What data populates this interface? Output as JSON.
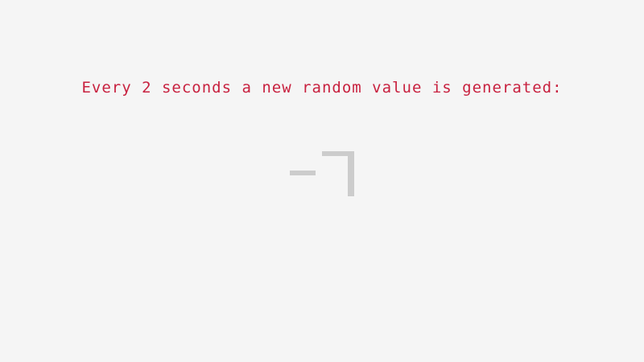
{
  "headline": {
    "text": "Every 2 seconds a new random value is generated:"
  },
  "display": {
    "value": "-7",
    "color": "#cccccc"
  },
  "colors": {
    "background": "#f5f5f5",
    "headline": "#c8213f"
  }
}
